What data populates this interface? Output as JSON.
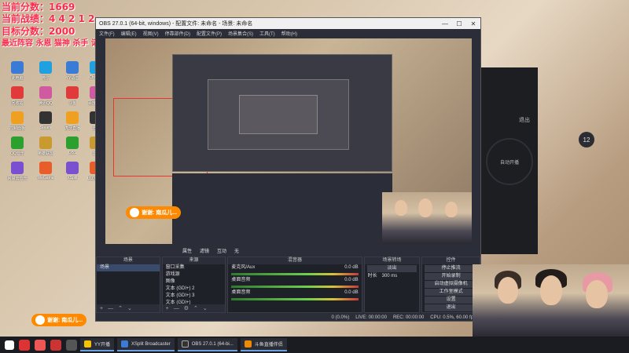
{
  "overlay": {
    "lines": [
      "当前分数：1669",
      "当前战绩：4  4  2  1  2",
      "目标分数：2000",
      "最近阵容 永恩 猫神 杀手 诺佛 ♥"
    ]
  },
  "obs": {
    "window_title": "OBS 27.0.1 (64-bit, windows) - 配置文件: 未命名 - 场景: 未命名",
    "menu": [
      "文件(F)",
      "编辑(E)",
      "视图(V)",
      "停靠部件(D)",
      "配置文件(P)",
      "场景集合(S)",
      "工具(T)",
      "帮助(H)"
    ],
    "scene_toolbar": [
      "属性",
      "滤镜",
      "互动",
      "无"
    ],
    "docks": {
      "scenes": {
        "title": "场景",
        "items": [
          "场景"
        ]
      },
      "sources": {
        "title": "来源",
        "items": [
          "窗口采集",
          "游戏源",
          "图像",
          "文本 (GDI+) 2",
          "文本 (GDI+) 3",
          "文本 (GDI+)"
        ]
      },
      "mixer": {
        "title": "混音器",
        "channels": [
          {
            "name": "麦克风/Aux",
            "db": "0.0 dB"
          },
          {
            "name": "桌面音频",
            "db": "0.0 dB"
          },
          {
            "name": "桌面音频",
            "db": "0.0 dB"
          }
        ]
      },
      "transitions": {
        "title": "场景转场",
        "type": "淡出",
        "duration_label": "时长",
        "duration": "300 ms"
      },
      "controls": {
        "title": "控件",
        "buttons": [
          "停止推流",
          "开始录制",
          "启动虚拟摄像机",
          "工作室模式",
          "设置",
          "退出"
        ]
      }
    },
    "status": {
      "dropped": "0 (0.0%)",
      "live": "LIVE: 00:00:00",
      "rec": "REC: 00:00:00",
      "cpu": "CPU: 0.5%, 60.00 fps"
    }
  },
  "right_panel": {
    "exit_label": "退出",
    "circle_label": "自动开播",
    "count": "12"
  },
  "gift": {
    "text": "谢谢: 南瓜儿..."
  },
  "taskbar": {
    "tasks": [
      "YY开播",
      "XSplit Broadcaster",
      "OBS 27.0.1 (64-bi...",
      "斗鱼直播伴侣"
    ]
  },
  "desktop_icons": [
    "此电脑",
    "回收站",
    "控制面板",
    "QQ音乐",
    "网易云音乐",
    "微信",
    "腾讯QQ",
    "Steam",
    "英雄联盟",
    "WeGame",
    "YY语音",
    "斗鱼",
    "虎牙直播",
    "OBS",
    "XSplit",
    "Chrome",
    "百度网盘",
    "迅雷",
    "雷神",
    "UU加速器"
  ],
  "icon_colors": [
    "#3a7bd5",
    "#e03a3a",
    "#f0a020",
    "#2ca02c",
    "#7a4fd0",
    "#1fa0e0",
    "#d05aa0",
    "#333",
    "#c89a30",
    "#e85d2a"
  ]
}
